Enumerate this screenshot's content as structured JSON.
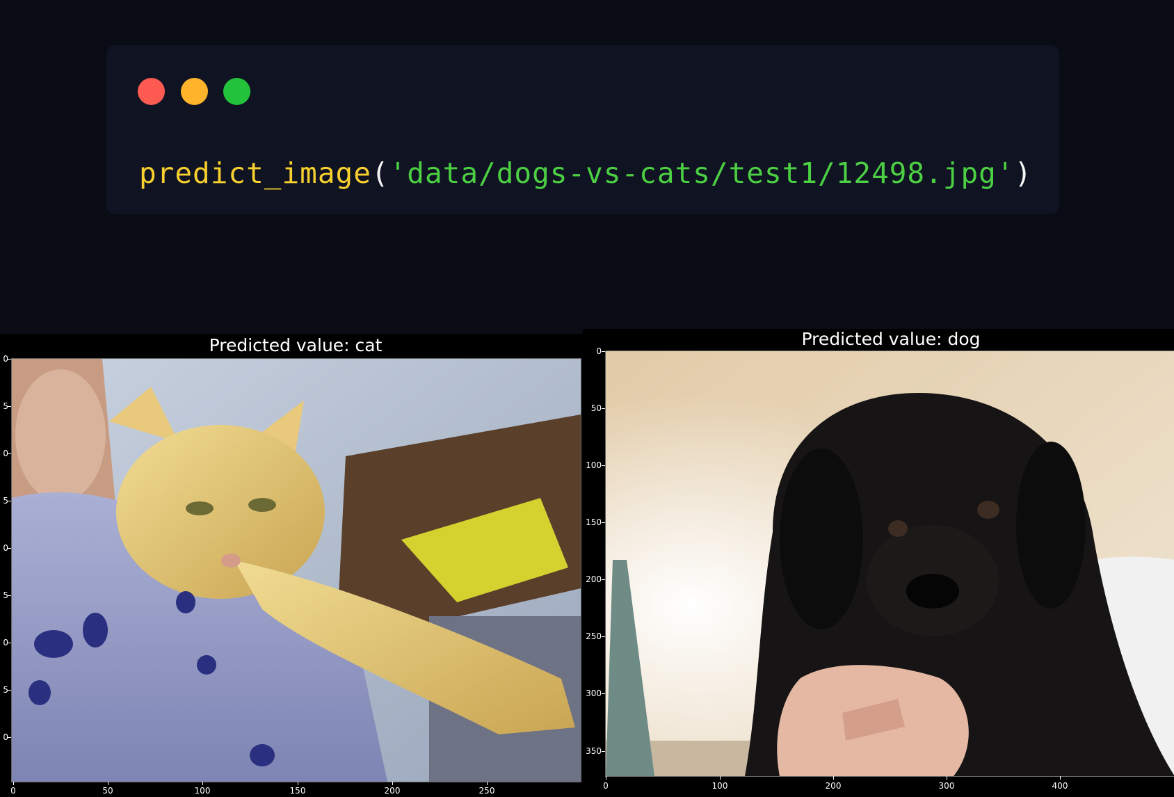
{
  "colors": {
    "page_background": "#090c14",
    "code_background": "#0f1322",
    "function": "#f7d02f",
    "paren": "#f4f4f4",
    "string": "#4ccf43",
    "dot_close": "#fd5a52",
    "dot_minimize": "#ffb42c",
    "dot_maximize": "#23c23b"
  },
  "code": {
    "function_name": "predict_image",
    "open_paren": "(",
    "argument": "'data/dogs-vs-cats/test1/12498.jpg'",
    "close_paren": ")"
  },
  "plots": [
    {
      "title": "Predicted value: cat",
      "photo_subject": "orange cat held by a person",
      "xticks": [
        "0",
        "50",
        "100",
        "150",
        "200",
        "250"
      ],
      "yticks": [
        "0",
        "5",
        "0",
        "5",
        "0",
        "5",
        "0",
        "5",
        "0"
      ]
    },
    {
      "title": "Predicted value: dog",
      "photo_subject": "black puppy held by a hand",
      "xticks": [
        "0",
        "100",
        "200",
        "300",
        "400"
      ],
      "yticks": [
        "0",
        "50",
        "100",
        "150",
        "200",
        "250",
        "300",
        "350"
      ]
    }
  ]
}
